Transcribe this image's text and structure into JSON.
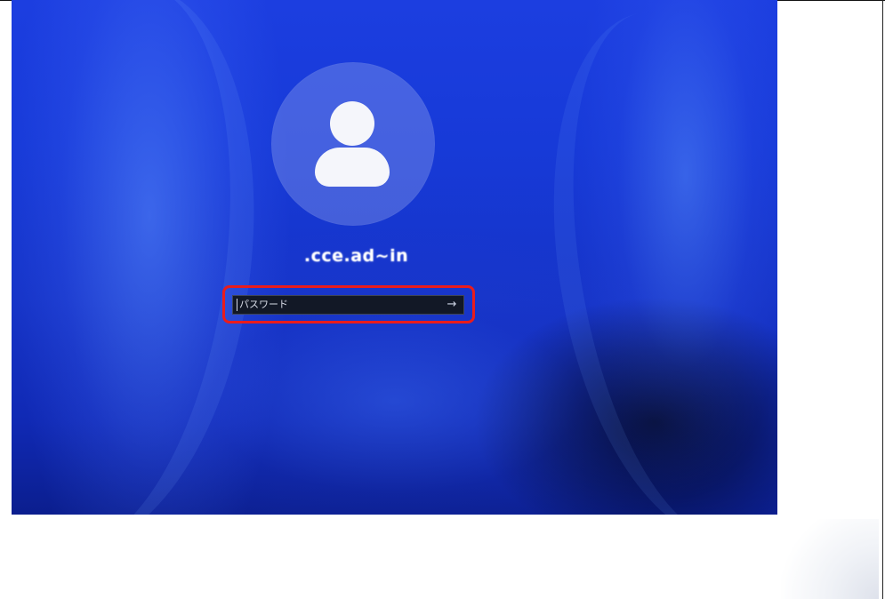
{
  "login": {
    "username": ".cce.ad~in",
    "password_placeholder": "パスワード",
    "password_value": "",
    "submit_icon": "arrow-right-icon",
    "submit_glyph": "→"
  },
  "colors": {
    "highlight": "#ea1c1c",
    "accent": "#1c3ee0"
  }
}
